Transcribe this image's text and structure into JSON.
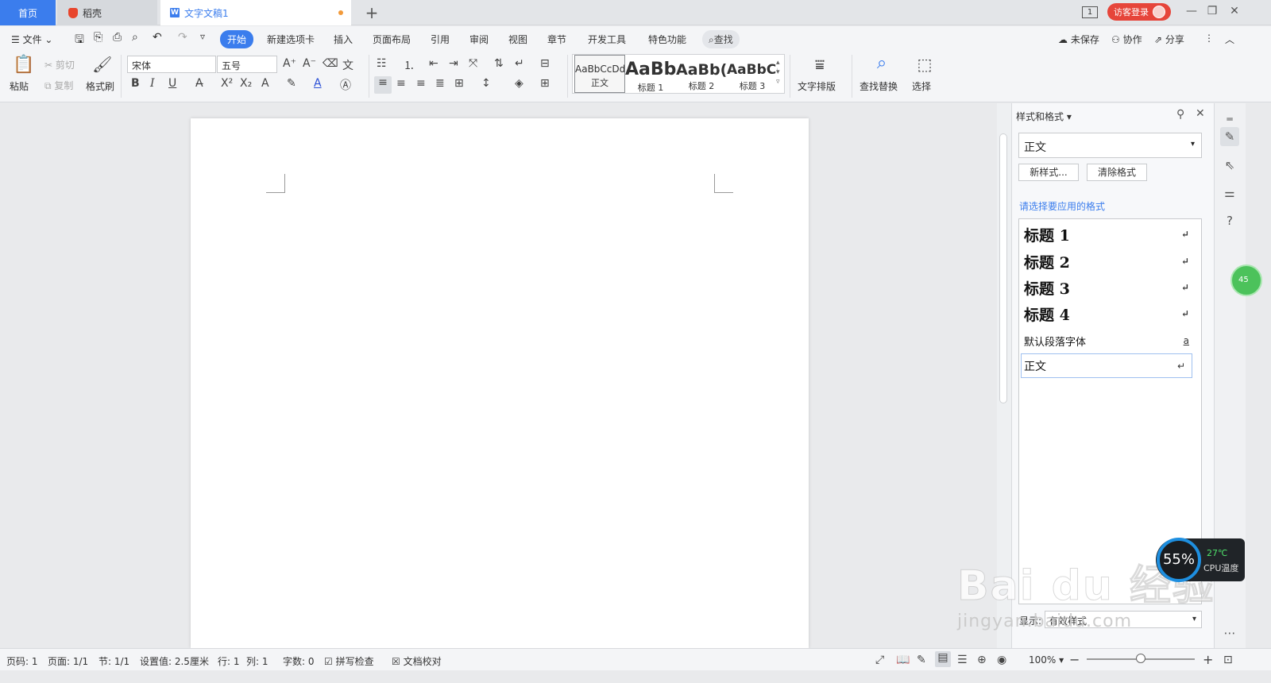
{
  "titlebar": {
    "tabs": [
      {
        "label": "首页"
      },
      {
        "label": "稻壳"
      },
      {
        "label": "文字文稿1"
      }
    ],
    "add_tab": "+",
    "window_badge": "1",
    "visitor_label": "访客登录",
    "controls": {
      "minimize": "—",
      "restore": "❐",
      "close": "✕"
    }
  },
  "menubar": {
    "file": "文件",
    "items": [
      "开始",
      "新建选项卡",
      "插入",
      "页面布局",
      "引用",
      "审阅",
      "视图",
      "章节",
      "开发工具",
      "特色功能"
    ],
    "search": "查找",
    "unsaved": "未保存",
    "collab": "协作",
    "share": "分享"
  },
  "ribbon": {
    "paste": "粘贴",
    "cut": "剪切",
    "copy": "复制",
    "format_painter": "格式刷",
    "font_name": "宋体",
    "font_size": "五号",
    "style_gallery": [
      {
        "preview": "AaBbCcDd",
        "name": "正文"
      },
      {
        "preview": "AaBb",
        "name": "标题 1"
      },
      {
        "preview": "AaBb(",
        "name": "标题 2"
      },
      {
        "preview": "AaBbC(",
        "name": "标题 3"
      }
    ],
    "text_layout": "文字排版",
    "find_replace": "查找替换",
    "select": "选择"
  },
  "panel": {
    "title": "样式和格式",
    "current_style": "正文",
    "new_style": "新样式...",
    "clear_format": "清除格式",
    "apply_label": "请选择要应用的格式",
    "styles": [
      {
        "name": "标题  1",
        "mark": "↵"
      },
      {
        "name": "标题  2",
        "mark": "↵"
      },
      {
        "name": "标题  3",
        "mark": "↵"
      },
      {
        "name": "标题  4",
        "mark": "↵"
      },
      {
        "name": "默认段落字体",
        "mark": "a"
      },
      {
        "name": "正文",
        "mark": "↵"
      }
    ],
    "show_label": "显示:",
    "show_value": "有效样式"
  },
  "statusbar": {
    "page": "页码: 1",
    "pages": "页面: 1/1",
    "section": "节: 1/1",
    "setting": "设置值: 2.5厘米",
    "row": "行: 1",
    "col": "列: 1",
    "words": "字数: 0",
    "spell": "拼写检查",
    "proof": "文档校对",
    "zoom": "100%",
    "zoom_level": 0.5
  },
  "overlays": {
    "cpu_percent": "55%",
    "cpu_temp": "27℃",
    "cpu_label": "CPU温度",
    "green_ball": "45",
    "watermark": "Bai du 经验",
    "watermark_url": "jingyan.baidu.com"
  },
  "colors": {
    "accent": "#3b7ded",
    "visitor": "#e6453a",
    "cpu_ring": "#1e8fe0"
  }
}
